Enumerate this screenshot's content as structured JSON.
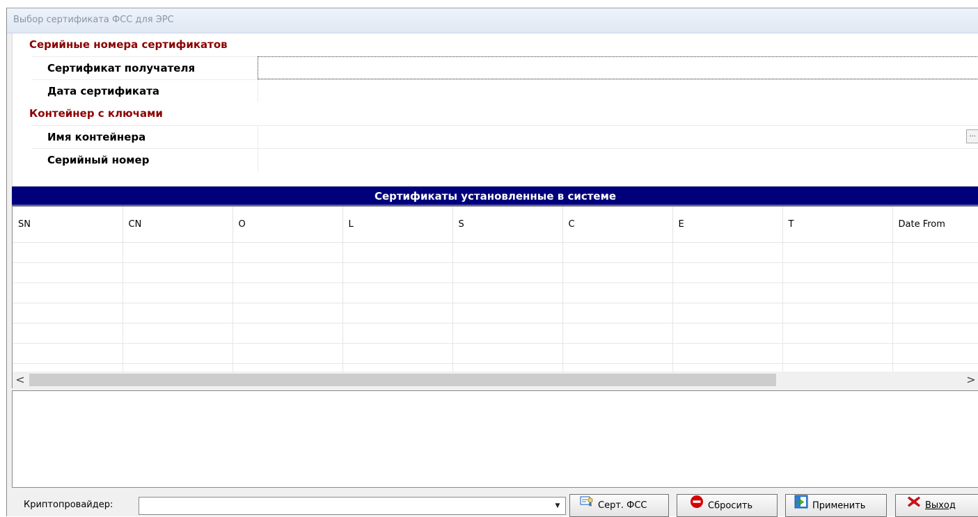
{
  "window": {
    "title": "Выбор сертификата ФСС для ЭРС"
  },
  "properties": {
    "cat_serials": "Серийные номера сертификатов",
    "recipient_cert_label": "Сертификат получателя",
    "recipient_cert_value": "",
    "cert_date_label": "Дата сертификата",
    "cert_date_value": "",
    "cat_container": "Контейнер с ключами",
    "container_name_label": "Имя контейнера",
    "container_name_value": "",
    "container_browse": "...",
    "serial_label": "Серийный номер",
    "serial_value": ""
  },
  "installed": {
    "title": "Сертификаты установленные в системе",
    "columns": [
      "SN",
      "CN",
      "O",
      "L",
      "S",
      "C",
      "E",
      "T",
      "Date From"
    ],
    "rows": []
  },
  "scrollbar": {
    "left": "<",
    "right": ">"
  },
  "bottom": {
    "crypto_label": "Криптопровайдер:",
    "crypto_value": "",
    "btn_fss": "Серт. ФСС",
    "btn_reset": "Сбросить",
    "btn_apply": "Применить",
    "btn_exit": "Выход"
  }
}
